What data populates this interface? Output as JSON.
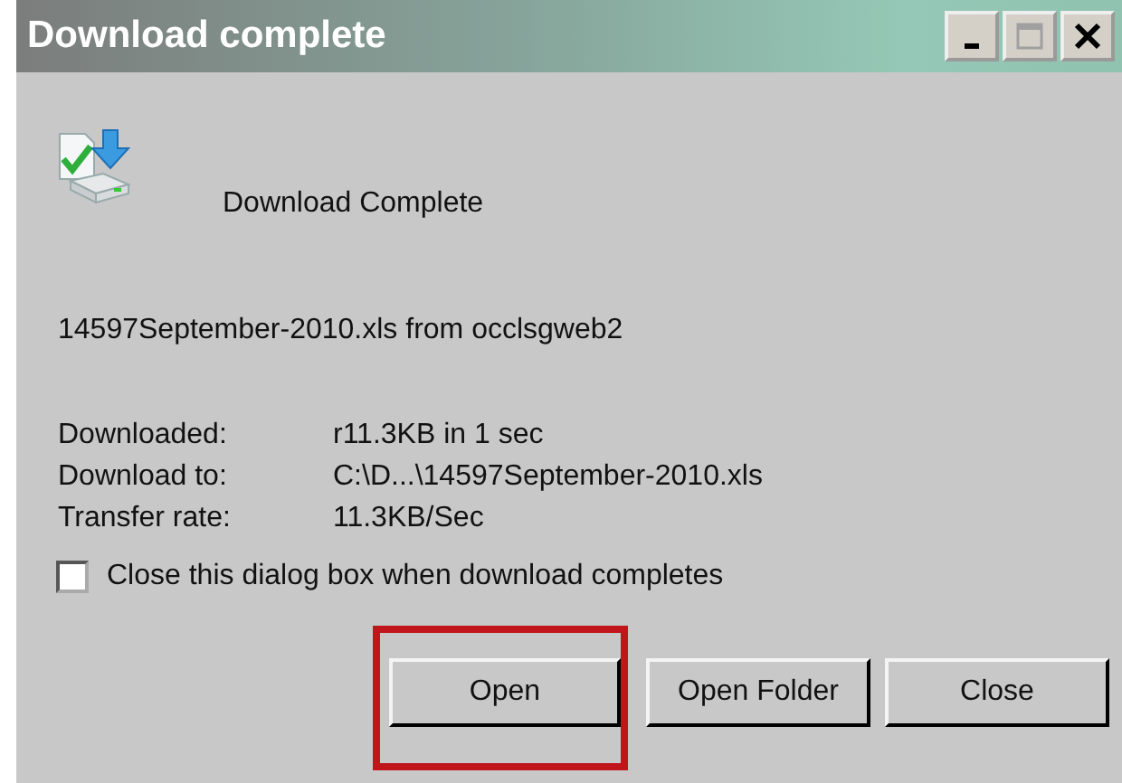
{
  "window": {
    "title": "Download complete",
    "controls": [
      {
        "kind": "minimize"
      },
      {
        "kind": "maximize",
        "disabled": true
      },
      {
        "kind": "close"
      }
    ]
  },
  "heading": "Download Complete",
  "file_line": "14597September-2010.xls from occlsgweb2",
  "details": [
    {
      "label": "Downloaded:",
      "value": "r11.3KB in 1 sec"
    },
    {
      "label": "Download to:",
      "value": "C:\\D...\\14597September-2010.xls"
    },
    {
      "label": "Transfer rate:",
      "value": "11.3KB/Sec"
    }
  ],
  "close_when_done": {
    "label": "Close this dialog box when download completes",
    "checked": false
  },
  "buttons": [
    {
      "label": "Open",
      "highlighted": true
    },
    {
      "label": "Open Folder",
      "highlighted": false
    },
    {
      "label": "Close",
      "highlighted": false
    }
  ]
}
